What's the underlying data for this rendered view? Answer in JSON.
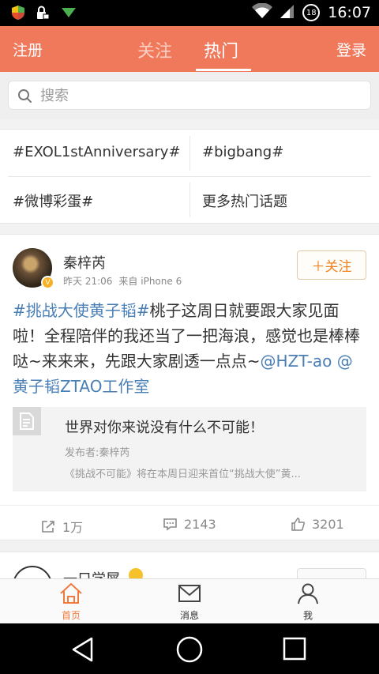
{
  "status_bar": {
    "time": "16:07",
    "badge": "18"
  },
  "nav": {
    "left": "注册",
    "tabs": [
      {
        "label": "关注",
        "active": false
      },
      {
        "label": "热门",
        "active": true
      }
    ],
    "right": "登录",
    "color": "#f0795c"
  },
  "search": {
    "placeholder": "搜索"
  },
  "topics": [
    "#EXOL1stAnniversary#",
    "#bigbang#",
    "#微博彩蛋#",
    "更多热门话题"
  ],
  "post": {
    "user": "秦梓芮",
    "time": "昨天 21:06",
    "source_prefix": "来自",
    "source": "iPhone 6",
    "follow_label": "＋关注",
    "text_hashtag": "#挑战大使黄子韬#",
    "text_body": "桃子这周日就要跟大家见面啦！全程陪伴的我还当了一把海浪，感觉也是棒棒哒~来来来，先跟大家剧透一点点~",
    "mention_1": "@HZT-ao",
    "mention_2": "@黄子韬ZTAO工作室",
    "quote": {
      "title": "世界对你来说没有什么不可能！",
      "author": "发布者:秦梓芮",
      "desc": "《挑战不可能》将在本周日迎来首位“挑战大使”黄..."
    },
    "reposts": "1万",
    "comments": "2143",
    "likes": "3201"
  },
  "next_post": {
    "user_partial": "一只学犀"
  },
  "tabbar": [
    {
      "label": "首页",
      "active": true
    },
    {
      "label": "消息",
      "active": false
    },
    {
      "label": "我",
      "active": false
    }
  ],
  "accent_color": "#f07b3f",
  "link_color": "#4a7fb6"
}
